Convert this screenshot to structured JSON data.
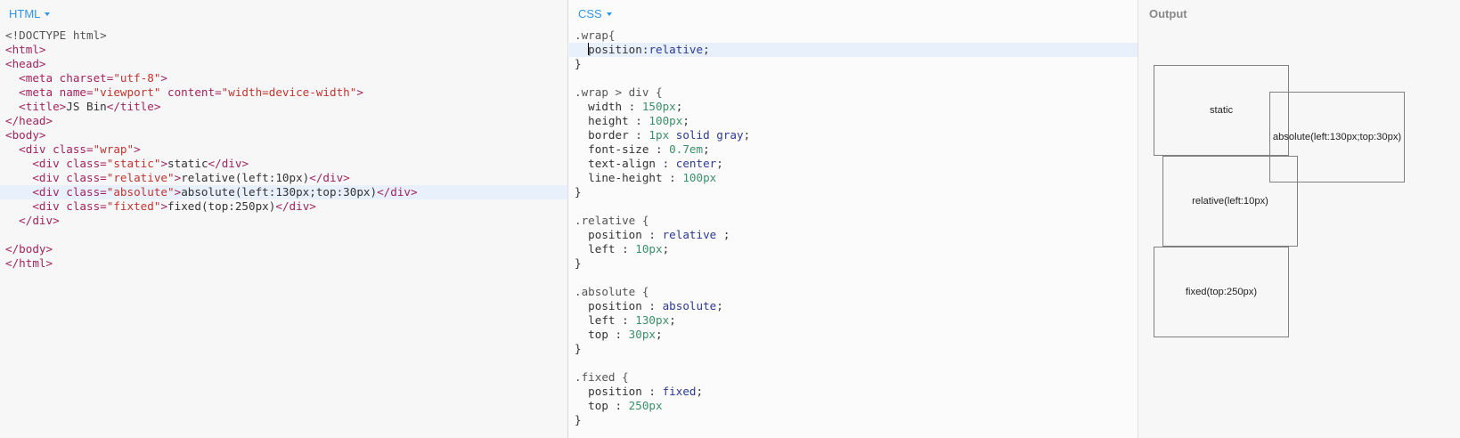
{
  "panels": {
    "html_label": "HTML",
    "css_label": "CSS",
    "output_label": "Output"
  },
  "html_code": [
    [
      [
        "doctype",
        "<!DOCTYPE html>"
      ]
    ],
    [
      [
        "tag",
        "<html>"
      ]
    ],
    [
      [
        "tag",
        "<head>"
      ]
    ],
    [
      [
        "text",
        "  "
      ],
      [
        "tag",
        "<meta "
      ],
      [
        "attr",
        "charset="
      ],
      [
        "val",
        "\"utf-8\""
      ],
      [
        "tag",
        ">"
      ]
    ],
    [
      [
        "text",
        "  "
      ],
      [
        "tag",
        "<meta "
      ],
      [
        "attr",
        "name="
      ],
      [
        "val",
        "\"viewport\""
      ],
      [
        "attr",
        " content="
      ],
      [
        "val",
        "\"width=device-width\""
      ],
      [
        "tag",
        ">"
      ]
    ],
    [
      [
        "text",
        "  "
      ],
      [
        "tag",
        "<title>"
      ],
      [
        "text",
        "JS Bin"
      ],
      [
        "tag",
        "</title>"
      ]
    ],
    [
      [
        "tag",
        "</head>"
      ]
    ],
    [
      [
        "tag",
        "<body>"
      ]
    ],
    [
      [
        "text",
        "  "
      ],
      [
        "tag",
        "<div "
      ],
      [
        "attr",
        "class="
      ],
      [
        "val",
        "\"wrap\""
      ],
      [
        "tag",
        ">"
      ]
    ],
    [
      [
        "text",
        "    "
      ],
      [
        "tag",
        "<div "
      ],
      [
        "attr",
        "class="
      ],
      [
        "val",
        "\"static\""
      ],
      [
        "tag",
        ">"
      ],
      [
        "text",
        "static"
      ],
      [
        "tag",
        "</div>"
      ]
    ],
    [
      [
        "text",
        "    "
      ],
      [
        "tag",
        "<div "
      ],
      [
        "attr",
        "class="
      ],
      [
        "val",
        "\"relative\""
      ],
      [
        "tag",
        ">"
      ],
      [
        "text",
        "relative(left:10px)"
      ],
      [
        "tag",
        "</div>"
      ]
    ],
    [
      [
        "text",
        "    "
      ],
      [
        "tag",
        "<div "
      ],
      [
        "attr",
        "class="
      ],
      [
        "val",
        "\"absolute\""
      ],
      [
        "tag",
        ">"
      ],
      [
        "text",
        "absolute(left:130px;top:30px)"
      ],
      [
        "tag",
        "</div>"
      ]
    ],
    [
      [
        "text",
        "    "
      ],
      [
        "tag",
        "<div "
      ],
      [
        "attr",
        "class="
      ],
      [
        "val",
        "\"fixted\""
      ],
      [
        "tag",
        ">"
      ],
      [
        "text",
        "fixed(top:250px)"
      ],
      [
        "tag",
        "</div>"
      ]
    ],
    [
      [
        "text",
        "  "
      ],
      [
        "tag",
        "</div>"
      ]
    ],
    [
      [
        "text",
        ""
      ]
    ],
    [
      [
        "tag",
        "</body>"
      ]
    ],
    [
      [
        "tag",
        "</html>"
      ]
    ]
  ],
  "html_active_line": 11,
  "css_code": [
    [
      [
        "sel",
        ".wrap{"
      ]
    ],
    [
      [
        "text",
        "  "
      ],
      [
        "cursor",
        ""
      ],
      [
        "prop",
        "position"
      ],
      [
        "punc",
        ":"
      ],
      [
        "kw",
        "relative"
      ],
      [
        "punc",
        ";"
      ]
    ],
    [
      [
        "punc",
        "}"
      ]
    ],
    [
      [
        "text",
        ""
      ]
    ],
    [
      [
        "sel",
        ".wrap > div {"
      ]
    ],
    [
      [
        "text",
        "  "
      ],
      [
        "prop",
        "width"
      ],
      [
        "punc",
        " : "
      ],
      [
        "num",
        "150px"
      ],
      [
        "punc",
        ";"
      ]
    ],
    [
      [
        "text",
        "  "
      ],
      [
        "prop",
        "height"
      ],
      [
        "punc",
        " : "
      ],
      [
        "num",
        "100px"
      ],
      [
        "punc",
        ";"
      ]
    ],
    [
      [
        "text",
        "  "
      ],
      [
        "prop",
        "border"
      ],
      [
        "punc",
        " : "
      ],
      [
        "num",
        "1px"
      ],
      [
        "kw",
        " solid"
      ],
      [
        "kw",
        " gray"
      ],
      [
        "punc",
        ";"
      ]
    ],
    [
      [
        "text",
        "  "
      ],
      [
        "prop",
        "font-size"
      ],
      [
        "punc",
        " : "
      ],
      [
        "num",
        "0.7em"
      ],
      [
        "punc",
        ";"
      ]
    ],
    [
      [
        "text",
        "  "
      ],
      [
        "prop",
        "text-align"
      ],
      [
        "punc",
        " : "
      ],
      [
        "kw",
        "center"
      ],
      [
        "punc",
        ";"
      ]
    ],
    [
      [
        "text",
        "  "
      ],
      [
        "prop",
        "line-height"
      ],
      [
        "punc",
        " : "
      ],
      [
        "num",
        "100px"
      ]
    ],
    [
      [
        "punc",
        "}"
      ]
    ],
    [
      [
        "text",
        ""
      ]
    ],
    [
      [
        "sel",
        ".relative {"
      ]
    ],
    [
      [
        "text",
        "  "
      ],
      [
        "prop",
        "position"
      ],
      [
        "punc",
        " : "
      ],
      [
        "kw",
        "relative"
      ],
      [
        "punc",
        " ;"
      ]
    ],
    [
      [
        "text",
        "  "
      ],
      [
        "prop",
        "left"
      ],
      [
        "punc",
        " : "
      ],
      [
        "num",
        "10px"
      ],
      [
        "punc",
        ";"
      ]
    ],
    [
      [
        "punc",
        "}"
      ]
    ],
    [
      [
        "text",
        ""
      ]
    ],
    [
      [
        "sel",
        ".absolute {"
      ]
    ],
    [
      [
        "text",
        "  "
      ],
      [
        "prop",
        "position"
      ],
      [
        "punc",
        " : "
      ],
      [
        "kw",
        "absolute"
      ],
      [
        "punc",
        ";"
      ]
    ],
    [
      [
        "text",
        "  "
      ],
      [
        "prop",
        "left"
      ],
      [
        "punc",
        " : "
      ],
      [
        "num",
        "130px"
      ],
      [
        "punc",
        ";"
      ]
    ],
    [
      [
        "text",
        "  "
      ],
      [
        "prop",
        "top"
      ],
      [
        "punc",
        " : "
      ],
      [
        "num",
        "30px"
      ],
      [
        "punc",
        ";"
      ]
    ],
    [
      [
        "punc",
        "}"
      ]
    ],
    [
      [
        "text",
        ""
      ]
    ],
    [
      [
        "sel",
        ".fixed {"
      ]
    ],
    [
      [
        "text",
        "  "
      ],
      [
        "prop",
        "position"
      ],
      [
        "punc",
        " : "
      ],
      [
        "kw",
        "fixed"
      ],
      [
        "punc",
        ";"
      ]
    ],
    [
      [
        "text",
        "  "
      ],
      [
        "prop",
        "top"
      ],
      [
        "punc",
        " : "
      ],
      [
        "num",
        "250px"
      ]
    ],
    [
      [
        "punc",
        "}"
      ]
    ]
  ],
  "css_active_line": 1,
  "output": {
    "static": "static",
    "absolute": "absolute(left:130px;top:30px)",
    "relative": "relative(left:10px)",
    "fixed": "fixed(top:250px)"
  },
  "colors": {
    "panel_label": "#2f95e7",
    "output_label": "#888888",
    "active_line": "#e8f0fb",
    "box_border": "gray"
  }
}
